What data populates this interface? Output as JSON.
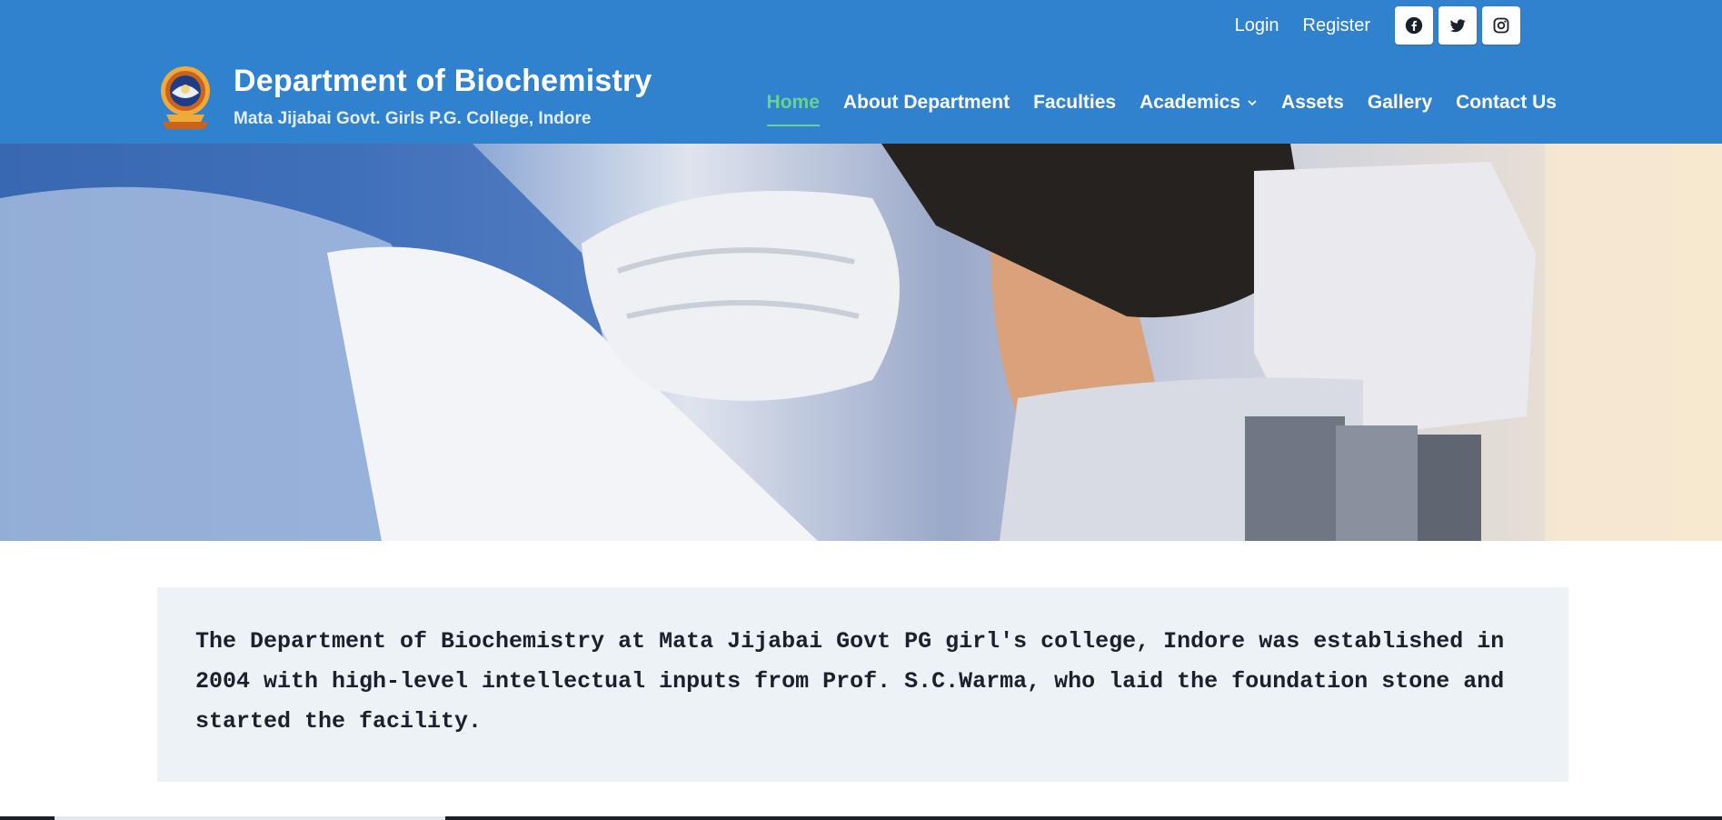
{
  "header": {
    "title": "Department of Biochemistry",
    "tagline": "Mata Jijabai Govt. Girls P.G. College, Indore",
    "logo_icon": "college-emblem",
    "top_links": [
      "Login",
      "Register"
    ],
    "social_icons": [
      "facebook-icon",
      "twitter-icon",
      "instagram-icon"
    ],
    "colors": {
      "header_bg": "#3182ce",
      "active_nav": "#68d391"
    }
  },
  "nav": {
    "items": [
      {
        "label": "Home",
        "active": true
      },
      {
        "label": "About Department"
      },
      {
        "label": "Faculties"
      },
      {
        "label": "Academics",
        "has_dropdown": true
      },
      {
        "label": "Assets"
      },
      {
        "label": "Gallery"
      },
      {
        "label": "Contact Us"
      }
    ]
  },
  "intro": {
    "text": "The Department of Biochemistry at Mata Jijabai Govt PG girl's college, Indore was established in 2004 with high-level intellectual inputs from Prof. S.C.Warma, who laid the foundation stone and started the facility."
  }
}
